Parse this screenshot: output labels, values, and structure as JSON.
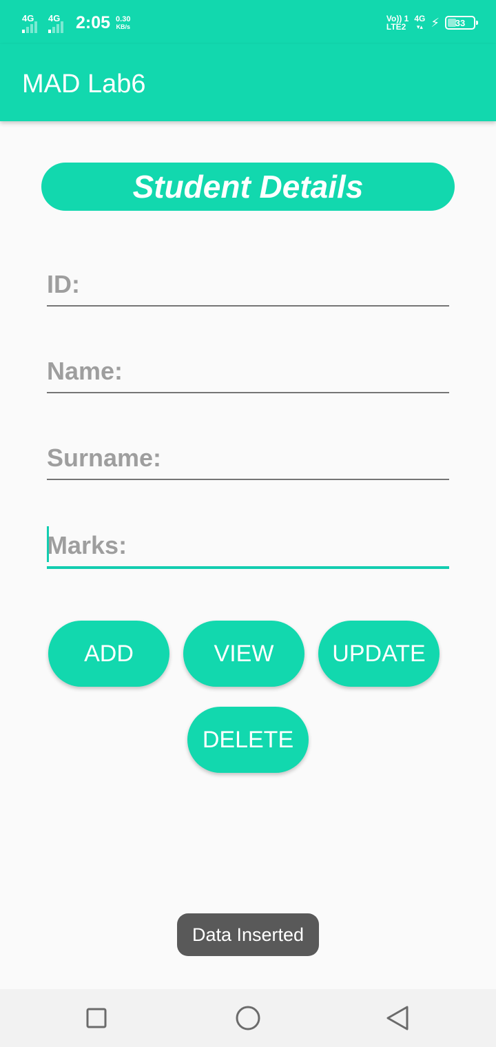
{
  "status_bar": {
    "sim1_network": "4G",
    "sim2_network": "4G",
    "time": "2:05",
    "speed_value": "0.30",
    "speed_unit": "KB/s",
    "volte_top": "Vo)) 1",
    "volte_bottom": "LTE2",
    "network_type": "4G",
    "network_arrows": "▾▴",
    "battery_level": "33"
  },
  "app_bar": {
    "title": "MAD Lab6"
  },
  "form": {
    "header": "Student Details",
    "fields": {
      "id": "ID:",
      "name": "Name:",
      "surname": "Surname:",
      "marks": "Marks:"
    }
  },
  "buttons": {
    "add": "ADD",
    "view": "VIEW",
    "update": "UPDATE",
    "delete": "DELETE"
  },
  "toast": {
    "message": "Data Inserted"
  },
  "colors": {
    "accent": "#12d8ae",
    "hint_text": "#9e9e9e",
    "toast_bg": "#595959"
  },
  "icons": {
    "nav_recent": "square-icon",
    "nav_home": "circle-icon",
    "nav_back": "triangle-back-icon"
  }
}
